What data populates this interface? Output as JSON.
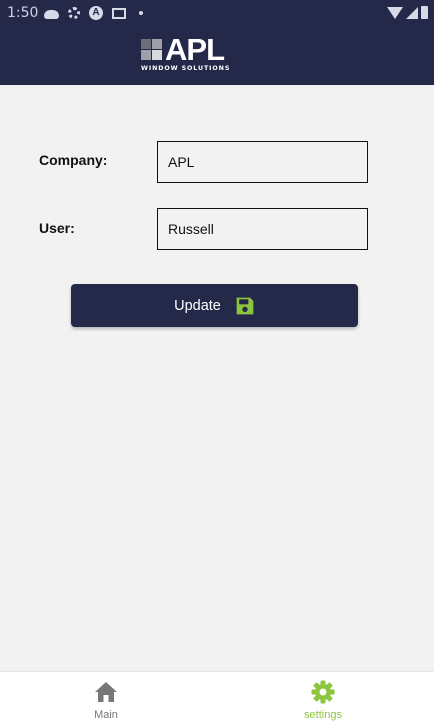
{
  "status_bar": {
    "time": "1:50",
    "left_icons": [
      "cloud-icon",
      "gear-icon",
      "a-icon",
      "mail-icon",
      "dot-icon"
    ],
    "right_icons": [
      "wifi-icon",
      "signal-icon",
      "battery-icon"
    ]
  },
  "header": {
    "logo_text": "APL",
    "logo_subtitle": "WINDOW SOLUTIONS"
  },
  "form": {
    "company_label": "Company:",
    "company_value": "APL",
    "user_label": "User:",
    "user_value": "Russell",
    "update_label": "Update",
    "update_icon": "save-icon"
  },
  "bottom_nav": {
    "items": [
      {
        "label": "Main",
        "icon": "home-icon",
        "active": false
      },
      {
        "label": "settings",
        "icon": "gear-icon",
        "active": true
      }
    ]
  },
  "colors": {
    "header_background": "#242849",
    "accent_green": "#8dc53e",
    "inactive_nav": "#777777",
    "content_background": "#f2f2f2"
  }
}
